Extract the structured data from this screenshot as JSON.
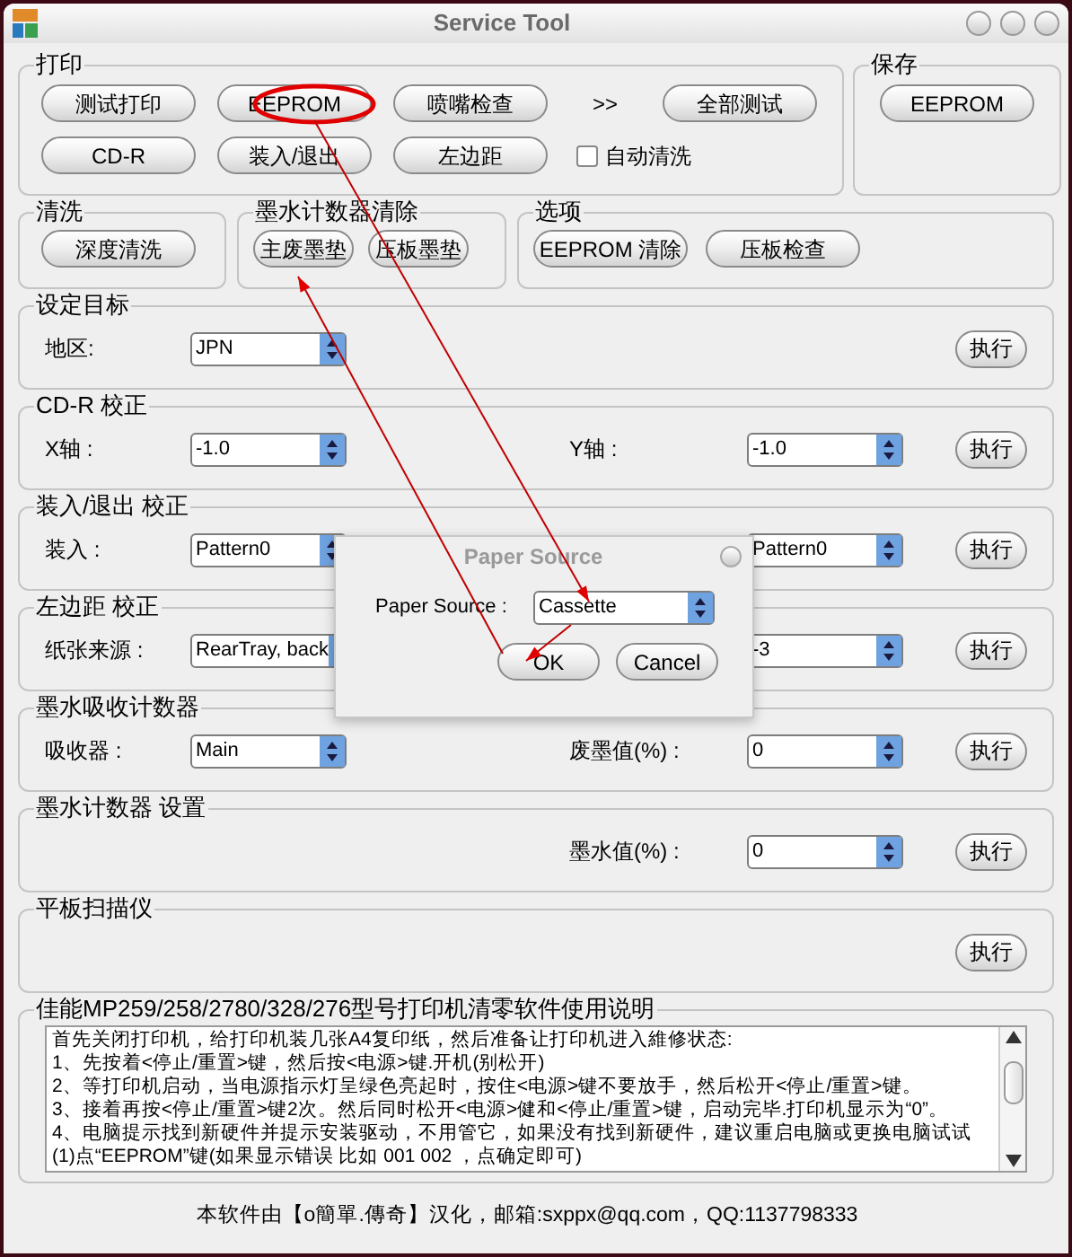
{
  "window": {
    "title": "Service Tool"
  },
  "print": {
    "title": "打印",
    "buttons": [
      "测试打印",
      "EEPROM",
      "喷嘴检查",
      "全部测试",
      "CD-R",
      "装入/退出",
      "左边距"
    ],
    "more": ">>",
    "auto_clean": {
      "label": "自动清洗",
      "checked": false
    }
  },
  "save": {
    "title": "保存",
    "buttons": [
      "EEPROM"
    ]
  },
  "clean": {
    "title": "清洗",
    "buttons": [
      "深度清洗"
    ]
  },
  "ink_reset": {
    "title": "墨水计数器清除",
    "buttons": [
      "主废墨垫",
      "压板墨垫"
    ]
  },
  "options": {
    "title": "选项",
    "buttons": [
      "EEPROM 清除",
      "压板检查"
    ]
  },
  "settings": [
    {
      "title": "设定目标",
      "left": {
        "label": "地区:",
        "value": "JPN"
      },
      "button": "执行"
    },
    {
      "title": "CD-R 校正",
      "left": {
        "label": "X轴 :",
        "value": "-1.0"
      },
      "right": {
        "label": "Y轴 :",
        "value": "-1.0"
      },
      "button": "执行"
    },
    {
      "title": "装入/退出 校正",
      "left": {
        "label": "装入 :",
        "value": "Pattern0"
      },
      "right": {
        "value": "Pattern0"
      },
      "button": "执行"
    },
    {
      "title": "左边距 校正",
      "left": {
        "label": "纸张来源 :",
        "value": "RearTray, back"
      },
      "right": {
        "value": "-3"
      },
      "button": "执行"
    },
    {
      "title": "墨水吸收计数器",
      "left": {
        "label": "吸收器 :",
        "value": "Main"
      },
      "right": {
        "label": "废墨值(%) :",
        "value": "0"
      },
      "button": "执行"
    },
    {
      "title": "墨水计数器 设置",
      "right": {
        "label": "墨水值(%) :",
        "value": "0"
      },
      "button": "执行"
    },
    {
      "title": "平板扫描仪",
      "button": "执行"
    }
  ],
  "manual": {
    "title": "佳能MP259/258/2780/328/276型号打印机清零软件使用说明",
    "lines": [
      "首先关闭打印机，给打印机装几张A4复印纸，然后准备让打印机进入維修状态:",
      "1、先按着<停止/重置>键，然后按<电源>键.开机(别松开)",
      "2、等打印机启动，当电源指示灯呈绿色亮起时，按住<电源>键不要放手，然后松开<停止/重置>键。",
      "3、接着再按<停止/重置>键2次。然后同时松开<电源>健和<停止/重置>键，启动完毕.打印机显示为“0”。",
      "4、电脑提示找到新硬件并提示安装驱动，不用管它，如果没有找到新硬件，建议重启电脑或更换电脑试试",
      "(1)点“EEPROM”键(如果显示错误  比如 001  002 ，点确定即可)"
    ]
  },
  "footer": "本软件由【o簡單.傳奇】汉化，邮箱:sxppx@qq.com，QQ:1137798333",
  "dialog": {
    "title": "Paper Source",
    "label": "Paper Source :",
    "value": "Cassette",
    "buttons": [
      "OK",
      "Cancel"
    ]
  }
}
